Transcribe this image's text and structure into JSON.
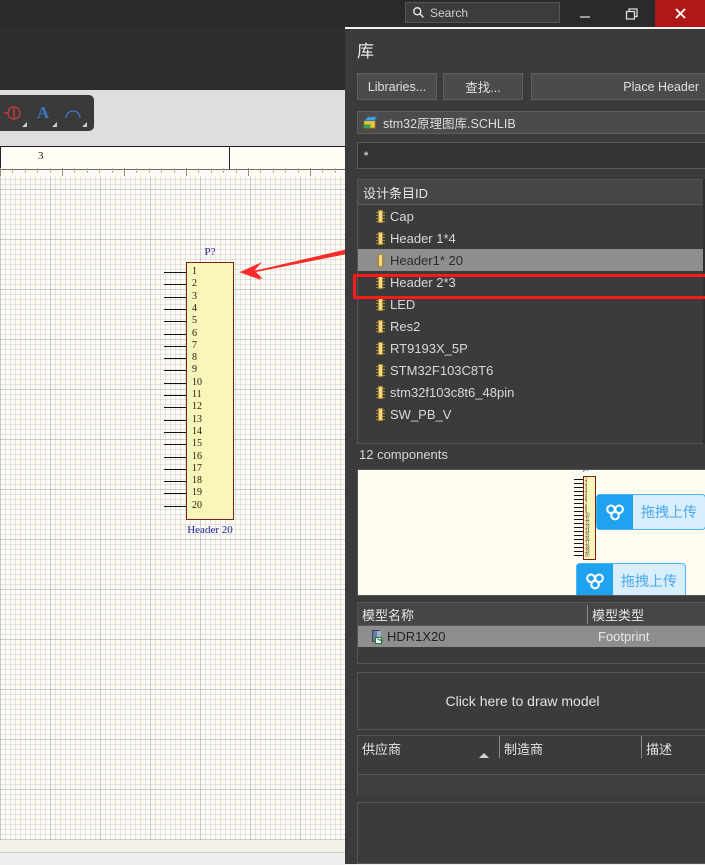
{
  "titlebar": {
    "search_placeholder": "Search",
    "search_icon": "search-icon",
    "minimize_label": "—",
    "maximize_label": "❐",
    "close_label": "✕",
    "close_color": "#b01818"
  },
  "editor": {
    "toolbar_icons": [
      "net-identifier-icon",
      "text-string-icon",
      "arc-icon"
    ],
    "ruler_label": "3"
  },
  "schematic": {
    "designator": "P?",
    "component_name": "Header 20",
    "pin_numbers": [
      "1",
      "2",
      "3",
      "4",
      "5",
      "6",
      "7",
      "8",
      "9",
      "10",
      "11",
      "12",
      "13",
      "14",
      "15",
      "16",
      "17",
      "18",
      "19",
      "20"
    ],
    "body_fill": "#faf5b8",
    "body_border": "#7c1f16",
    "label_color": "#22229a",
    "annotation_arrow_color": "#ff2020"
  },
  "library_panel": {
    "title": "库",
    "buttons": {
      "libraries": "Libraries...",
      "find": "查找...",
      "place": "Place Header"
    },
    "library_file": "stm32原理图库.SCHLIB",
    "library_file_icon": "library-file-icon",
    "filter_value": "*",
    "list_header": "设计条目ID",
    "components": [
      {
        "name": "Cap",
        "selected": false
      },
      {
        "name": "Header 1*4",
        "selected": false
      },
      {
        "name": "Header1* 20",
        "selected": true
      },
      {
        "name": "Header 2*3",
        "selected": false
      },
      {
        "name": "LED",
        "selected": false
      },
      {
        "name": "Res2",
        "selected": false
      },
      {
        "name": "RT9193X_5P",
        "selected": false
      },
      {
        "name": "STM32F103C8T6",
        "selected": false
      },
      {
        "name": "stm32f103c8t6_48pin",
        "selected": false
      },
      {
        "name": "SW_PB_V",
        "selected": false
      }
    ],
    "component_count": "12 components",
    "highlight_color": "#ff1a1a",
    "selection_color": "#8e8e8e"
  },
  "preview": {
    "designator": "P?",
    "watermarks": [
      {
        "text": "拖拽上传",
        "icon": "cloud-upload-icon"
      },
      {
        "text": "拖拽上传",
        "icon": "cloud-upload-icon"
      }
    ]
  },
  "model_table": {
    "headers": [
      "模型名称",
      "模型类型"
    ],
    "rows": [
      {
        "name": "HDR1X20",
        "type": "Footprint",
        "icon": "footprint-icon"
      }
    ]
  },
  "draw_model": {
    "label": "Click here to draw model"
  },
  "supplier_table": {
    "headers": [
      "供应商",
      "制造商",
      "描述"
    ],
    "sort_indicator": "sort-ascending-icon",
    "rows": []
  }
}
